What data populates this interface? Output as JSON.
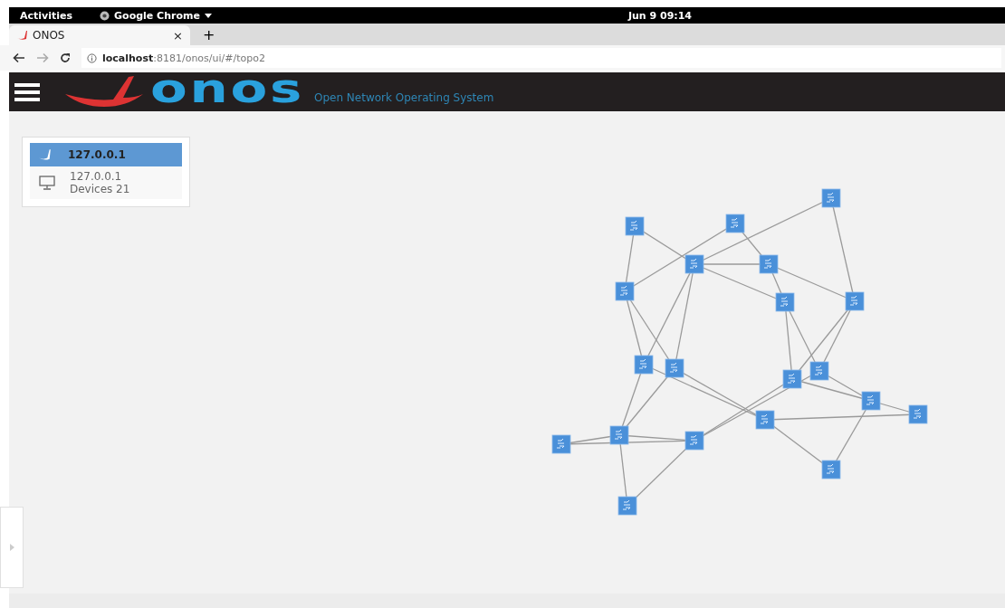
{
  "system_bar": {
    "activities": "Activities",
    "app_menu": "Google Chrome",
    "clock": "Jun 9  09:14"
  },
  "tabs": [
    {
      "title": "ONOS",
      "selected": true,
      "close": "×"
    }
  ],
  "new_tab": "+",
  "address_bar": {
    "host": "localhost",
    "path": ":8181/onos/ui/#/topo2"
  },
  "header": {
    "logo_text": "onos",
    "tagline": "Open Network Operating System"
  },
  "cluster_panel": {
    "title": "127.0.0.1",
    "selected": true,
    "node_name": "127.0.0.1",
    "devices": "Devices 21"
  }
}
